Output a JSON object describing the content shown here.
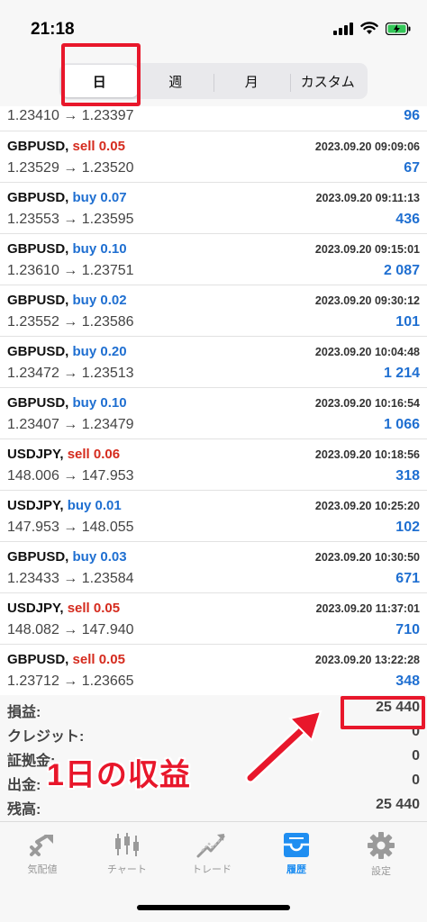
{
  "status": {
    "time": "21:18"
  },
  "tabs_period": [
    "日",
    "週",
    "月",
    "カスタム"
  ],
  "partial_row": {
    "prices": "1.23410 → 1.23397",
    "profit": "96"
  },
  "trades": [
    {
      "symbol": "GBPUSD,",
      "side": "sell",
      "volume": "0.05",
      "time": "2023.09.20 09:09:06",
      "prices": "1.23529 → 1.23520",
      "profit": "67"
    },
    {
      "symbol": "GBPUSD,",
      "side": "buy",
      "volume": "0.07",
      "time": "2023.09.20 09:11:13",
      "prices": "1.23553 → 1.23595",
      "profit": "436"
    },
    {
      "symbol": "GBPUSD,",
      "side": "buy",
      "volume": "0.10",
      "time": "2023.09.20 09:15:01",
      "prices": "1.23610 → 1.23751",
      "profit": "2 087"
    },
    {
      "symbol": "GBPUSD,",
      "side": "buy",
      "volume": "0.02",
      "time": "2023.09.20 09:30:12",
      "prices": "1.23552 → 1.23586",
      "profit": "101"
    },
    {
      "symbol": "GBPUSD,",
      "side": "buy",
      "volume": "0.20",
      "time": "2023.09.20 10:04:48",
      "prices": "1.23472 → 1.23513",
      "profit": "1 214"
    },
    {
      "symbol": "GBPUSD,",
      "side": "buy",
      "volume": "0.10",
      "time": "2023.09.20 10:16:54",
      "prices": "1.23407 → 1.23479",
      "profit": "1 066"
    },
    {
      "symbol": "USDJPY,",
      "side": "sell",
      "volume": "0.06",
      "time": "2023.09.20 10:18:56",
      "prices": "148.006 → 147.953",
      "profit": "318"
    },
    {
      "symbol": "USDJPY,",
      "side": "buy",
      "volume": "0.01",
      "time": "2023.09.20 10:25:20",
      "prices": "147.953 → 148.055",
      "profit": "102"
    },
    {
      "symbol": "GBPUSD,",
      "side": "buy",
      "volume": "0.03",
      "time": "2023.09.20 10:30:50",
      "prices": "1.23433 → 1.23584",
      "profit": "671"
    },
    {
      "symbol": "USDJPY,",
      "side": "sell",
      "volume": "0.05",
      "time": "2023.09.20 11:37:01",
      "prices": "148.082 → 147.940",
      "profit": "710"
    },
    {
      "symbol": "GBPUSD,",
      "side": "sell",
      "volume": "0.05",
      "time": "2023.09.20 13:22:28",
      "prices": "1.23712 → 1.23665",
      "profit": "348"
    }
  ],
  "summary": [
    {
      "label": "損益:",
      "value": "25 440"
    },
    {
      "label": "クレジット:",
      "value": "0"
    },
    {
      "label": "証拠金:",
      "value": "0"
    },
    {
      "label": "出金:",
      "value": "0"
    },
    {
      "label": "残高:",
      "value": "25 440"
    }
  ],
  "annotation": "1日の収益",
  "tabbar": [
    {
      "label": "気配値",
      "icon": "quotes-icon"
    },
    {
      "label": "チャート",
      "icon": "chart-icon"
    },
    {
      "label": "トレード",
      "icon": "trade-icon"
    },
    {
      "label": "履歴",
      "icon": "history-icon",
      "active": true
    },
    {
      "label": "設定",
      "icon": "settings-icon"
    }
  ],
  "colors": {
    "sell": "#d52b1e",
    "buy": "#1f6fd1",
    "annotation": "#e8172b",
    "active_tab": "#1f8ef1"
  }
}
